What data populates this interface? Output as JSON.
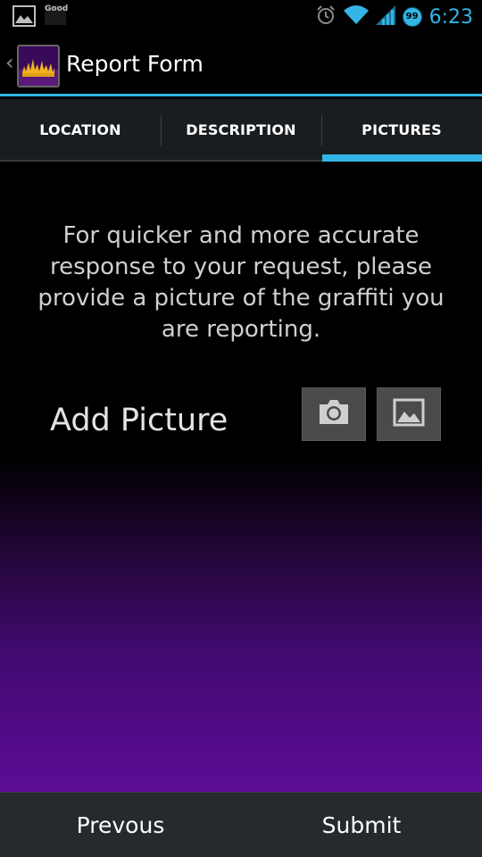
{
  "status_bar": {
    "notification_icons": [
      "image-icon",
      "good-app-icon"
    ],
    "good_label": "Good",
    "time": "6:23",
    "badge_count": "99",
    "system_icons": [
      "alarm-icon",
      "wifi-icon",
      "signal-icon"
    ],
    "accent_color": "#33b5e5"
  },
  "action_bar": {
    "title": "Report Form",
    "up_glyph": "‹"
  },
  "tabs": [
    {
      "label": "LOCATION",
      "selected": false
    },
    {
      "label": "DESCRIPTION",
      "selected": false
    },
    {
      "label": "PICTURES",
      "selected": true
    }
  ],
  "content": {
    "instructions": "For quicker and more accurate response to your request, please provide a picture of the graffiti you are reporting.",
    "add_picture_label": "Add Picture",
    "buttons": [
      {
        "icon": "camera-icon"
      },
      {
        "icon": "gallery-icon"
      }
    ]
  },
  "bottom_bar": {
    "previous_label": "Prevous",
    "submit_label": "Submit"
  },
  "colors": {
    "accent": "#33b5e5",
    "gradient_bottom": "#5c0c96",
    "tab_bg": "#1a1d20",
    "bottom_bar_bg": "#26292d"
  }
}
